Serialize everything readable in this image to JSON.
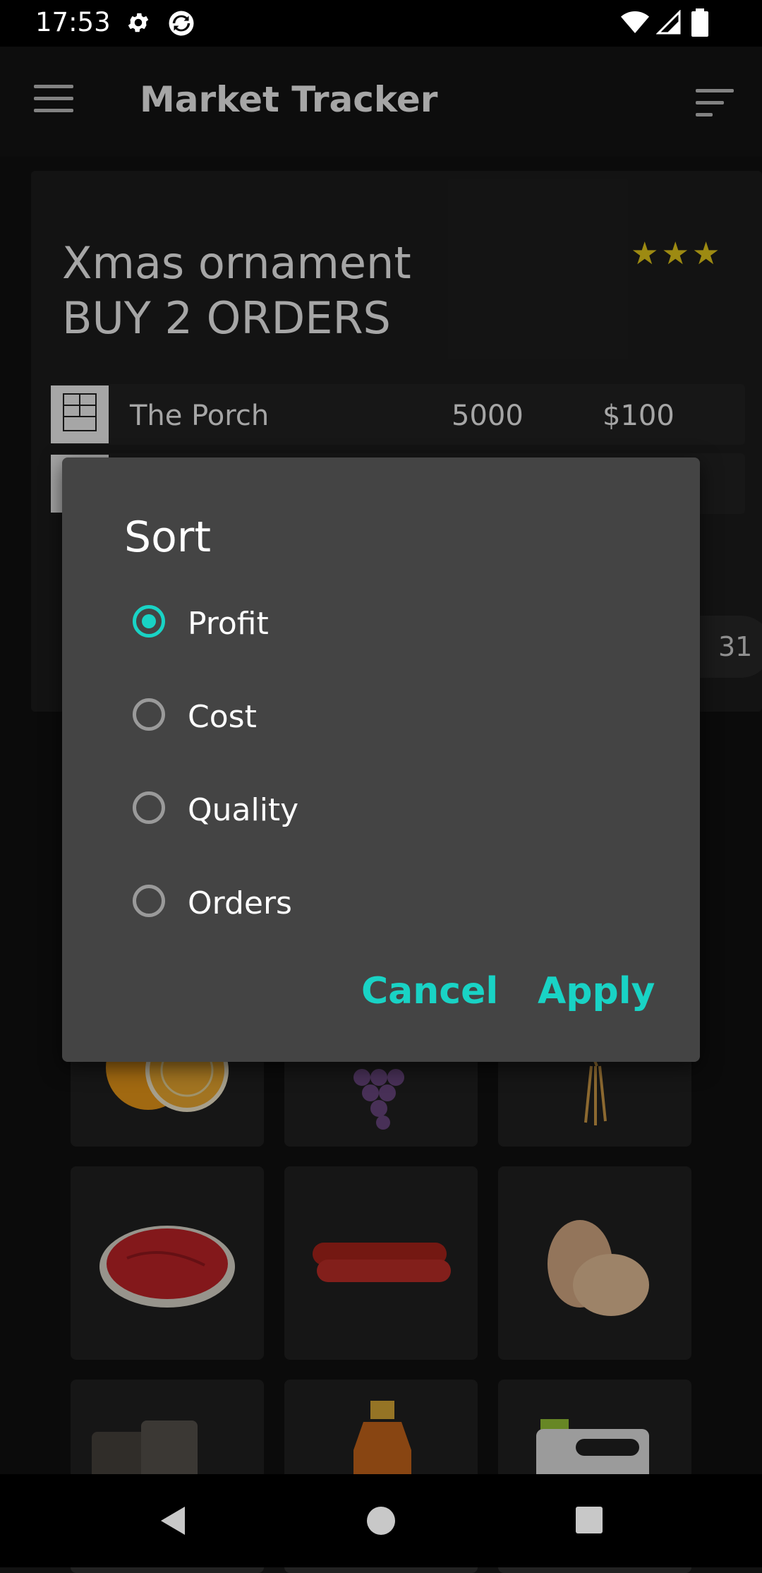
{
  "status_bar": {
    "time": "17:53"
  },
  "app_bar": {
    "title": "Market Tracker"
  },
  "card": {
    "name_line1": "Xmas ornament",
    "name_line2": "BUY 2 ORDERS",
    "stars": "★★★",
    "rating": 3,
    "rows": [
      {
        "name": "The Porch",
        "quantity": "5000",
        "price": "$100"
      },
      {
        "name": "",
        "quantity": "",
        "price": ""
      }
    ],
    "pill_text": "31"
  },
  "dialog": {
    "title": "Sort",
    "options": [
      {
        "label": "Profit",
        "selected": true
      },
      {
        "label": "Cost",
        "selected": false
      },
      {
        "label": "Quality",
        "selected": false
      },
      {
        "label": "Orders",
        "selected": false
      }
    ],
    "cancel_label": "Cancel",
    "apply_label": "Apply"
  },
  "grid_items": [
    "orange",
    "grapes",
    "vanilla",
    "meat",
    "sausages",
    "eggs",
    "oil-barrels",
    "syrup-bottle",
    "canister"
  ],
  "colors": {
    "accent": "#19d3c5",
    "star": "#f1d51d",
    "dialog": "#444444",
    "card": "#1e1e1e"
  }
}
